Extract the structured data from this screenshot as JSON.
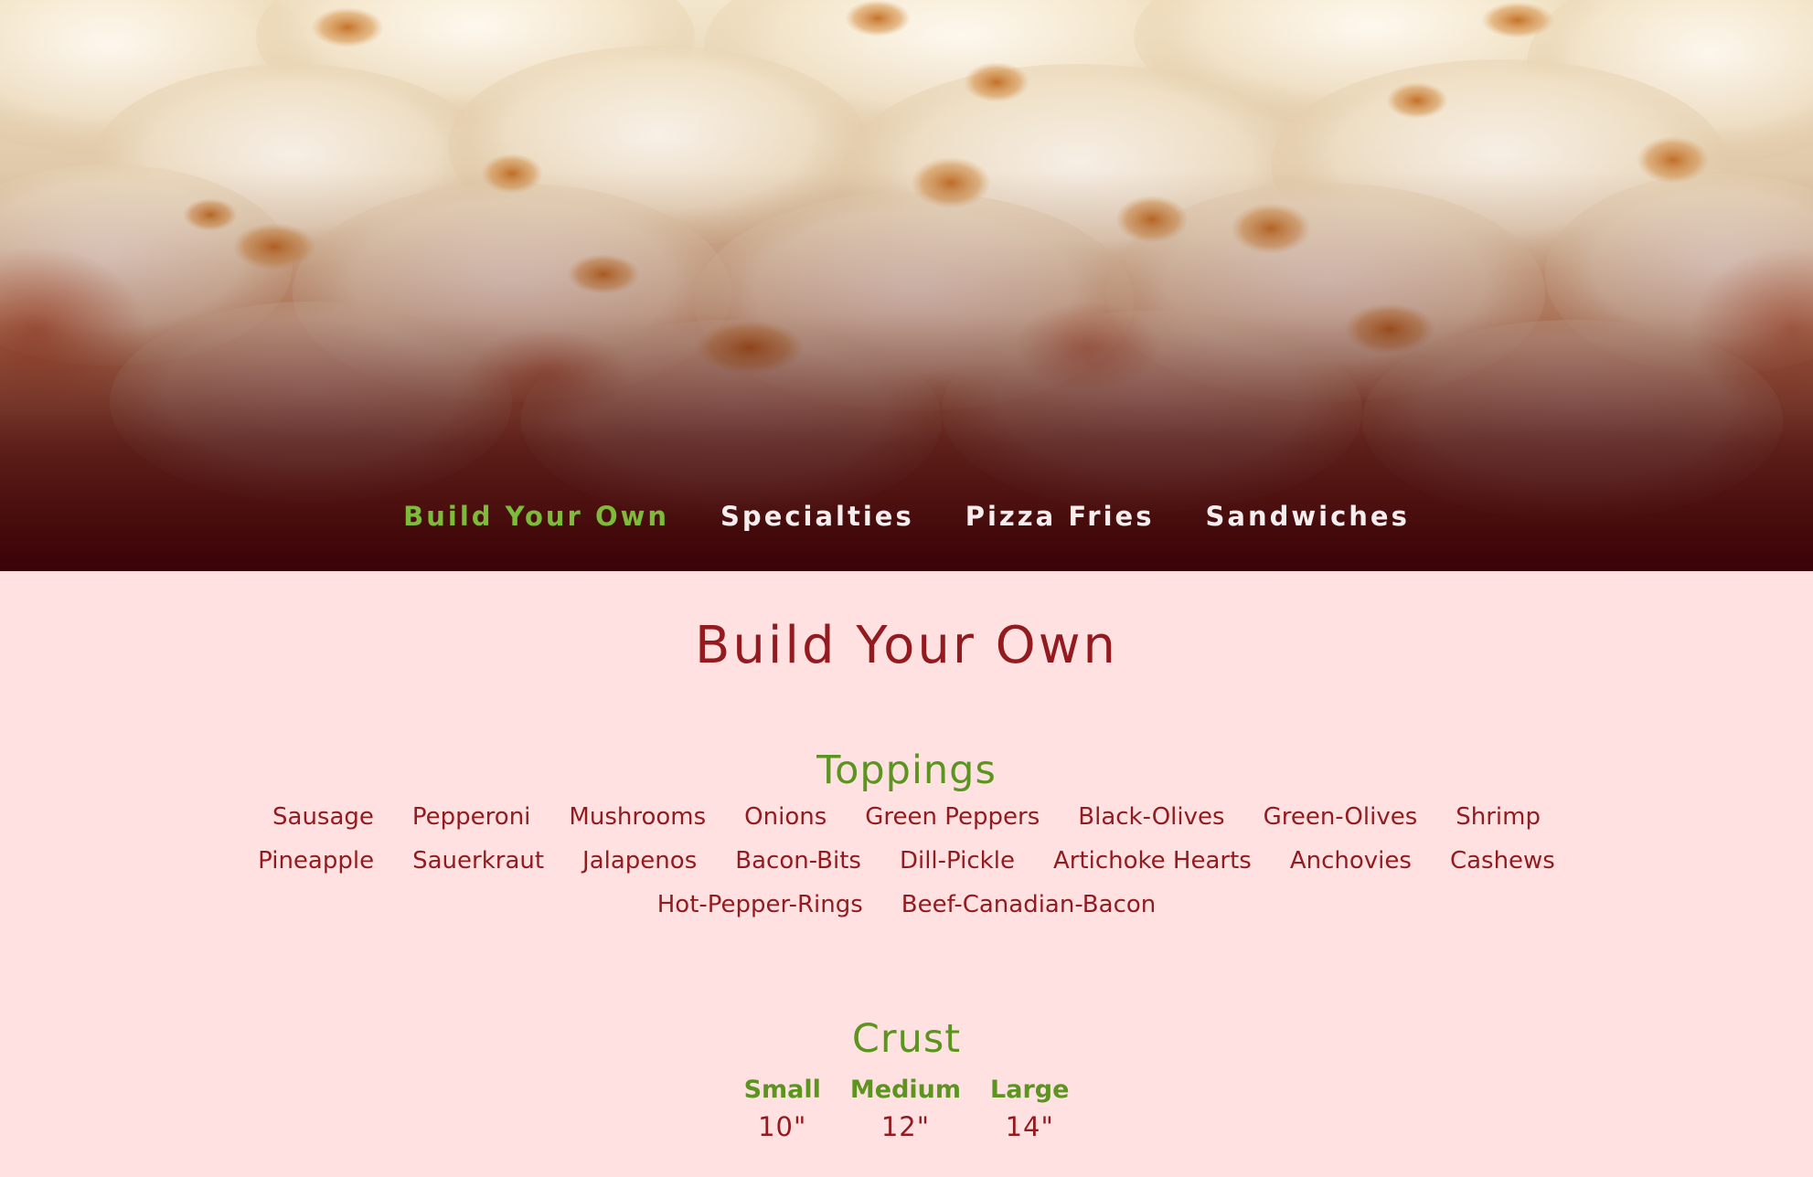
{
  "nav": {
    "items": [
      {
        "label": "Build Your Own",
        "active": true
      },
      {
        "label": "Specialties",
        "active": false
      },
      {
        "label": "Pizza Fries",
        "active": false
      },
      {
        "label": "Sandwiches",
        "active": false
      }
    ]
  },
  "main": {
    "title": "Build Your Own",
    "toppings": {
      "heading": "Toppings",
      "items": [
        "Sausage",
        "Pepperoni",
        "Mushrooms",
        "Onions",
        "Green Peppers",
        "Black-Olives",
        "Green-Olives",
        "Shrimp",
        "Pineapple",
        "Sauerkraut",
        "Jalapenos",
        "Bacon-Bits",
        "Dill-Pickle",
        "Artichoke Hearts",
        "Anchovies",
        "Cashews",
        "Hot-Pepper-Rings",
        "Beef-Canadian-Bacon"
      ]
    },
    "crust": {
      "heading": "Crust",
      "sizes": [
        {
          "name": "Small",
          "inches": "10\""
        },
        {
          "name": "Medium",
          "inches": "12\""
        },
        {
          "name": "Large",
          "inches": "14\""
        }
      ]
    }
  },
  "colors": {
    "accent_green": "#7dbb3a",
    "heading_green": "#5c9420",
    "text_red": "#931a1f",
    "page_background": "#ffe1e1",
    "hero_fade": "#3a0005"
  }
}
